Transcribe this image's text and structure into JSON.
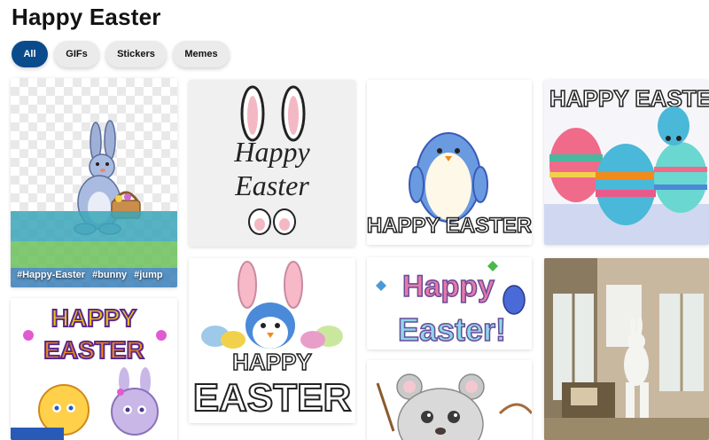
{
  "page": {
    "title": "Happy Easter"
  },
  "filters": {
    "items": [
      {
        "label": "All",
        "active": true
      },
      {
        "label": "GIFs",
        "active": false
      },
      {
        "label": "Stickers",
        "active": false
      },
      {
        "label": "Memes",
        "active": false
      }
    ]
  },
  "colors": {
    "accent": "#0a4b8c",
    "chip_bg": "#ebebeb",
    "text": "#121212"
  },
  "results": [
    {
      "id": "bunny-happy-easter",
      "description_icon": "bunny-with-basket-icon",
      "tags": [
        "#Happy-Easter",
        "#bunny",
        "#jump"
      ]
    },
    {
      "id": "ears-happy-easter",
      "text_lines": [
        "Happy",
        "Easter"
      ]
    },
    {
      "id": "penguin-happy-easter",
      "text": "HAPPY EASTER"
    },
    {
      "id": "eggs-happy-easter",
      "text": "HAPPY EASTER"
    },
    {
      "id": "kids-happy-easter",
      "text_lines": [
        "HAPPY",
        "EASTER"
      ]
    },
    {
      "id": "penguin-bunny-ears",
      "text_lines": [
        "HAPPY",
        "EASTER"
      ]
    },
    {
      "id": "colorful-happy-easter",
      "text_lines": [
        "Happy",
        "Easter!"
      ]
    },
    {
      "id": "bear-painting-eggs"
    },
    {
      "id": "person-bunny-costume"
    }
  ]
}
